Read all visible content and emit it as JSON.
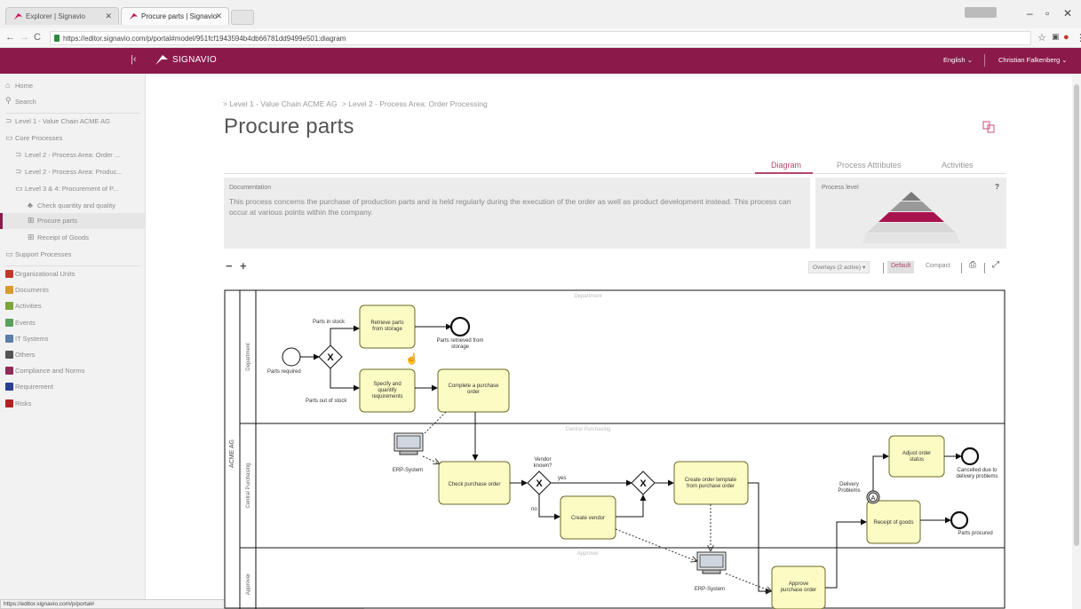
{
  "browser": {
    "tabs": [
      {
        "label": "Explorer | Signavio",
        "active": false
      },
      {
        "label": "Procure parts | Signavio",
        "active": true
      }
    ],
    "url": "https://editor.signavio.com/p/portal#model/951fcf1943594b4db66781dd9499e501:diagram",
    "status_url": "https://editor.signavio.com/p/portal#"
  },
  "header": {
    "brand": "SIGNAVIO",
    "language": "English",
    "user": "Christian Falkenberg",
    "bar_color": "#8b1a4b"
  },
  "sidebar": {
    "items": [
      {
        "label": "Home",
        "icon": "home-icon"
      },
      {
        "label": "Search",
        "icon": "search-icon"
      },
      {
        "label": "Level 1 - Value Chain ACME AG",
        "icon": "value-chain-icon"
      },
      {
        "label": "Core Processes",
        "icon": "folder-open-icon"
      },
      {
        "label": "Level 2 - Process Area: Order ...",
        "icon": "value-chain-icon"
      },
      {
        "label": "Level 2 - Process Area: Produc...",
        "icon": "value-chain-icon"
      },
      {
        "label": "Level 3 & 4: Procurement of P...",
        "icon": "folder-open-icon"
      },
      {
        "label": "Check quantity and quality",
        "icon": "org-chart-icon"
      },
      {
        "label": "Procure parts",
        "icon": "process-icon",
        "active": true
      },
      {
        "label": "Receipt of Goods",
        "icon": "process-icon"
      },
      {
        "label": "Support Processes",
        "icon": "folder-icon"
      }
    ],
    "dictionary": [
      {
        "label": "Organizational Units",
        "color": "#c0392b"
      },
      {
        "label": "Documents",
        "color": "#d69a2d"
      },
      {
        "label": "Activities",
        "color": "#7fa33b"
      },
      {
        "label": "Events",
        "color": "#5aa05a"
      },
      {
        "label": "IT Systems",
        "color": "#5a7fa8"
      },
      {
        "label": "Others",
        "color": "#555555"
      },
      {
        "label": "Compliance and Norms",
        "color": "#8e2b5a"
      },
      {
        "label": "Requirement",
        "color": "#2c3e8f"
      },
      {
        "label": "Risks",
        "color": "#b22222"
      }
    ]
  },
  "main": {
    "breadcrumb": [
      {
        "label": "> Level 1 - Value Chain ACME AG"
      },
      {
        "label": "> Level 2 - Process Area: Order Processing"
      }
    ],
    "title": "Procure parts",
    "tabs": [
      {
        "label": "Diagram",
        "active": true
      },
      {
        "label": "Process Attributes",
        "active": false
      },
      {
        "label": "Activities",
        "active": false
      }
    ],
    "documentation_label": "Documentation",
    "documentation": "This process concerns the purchase of production parts and is held regularly during the execution of the order as well as product development instead. This process can occur at various points within the company.",
    "process_level_label": "Process level",
    "process_level_help": "?",
    "toolbar": {
      "zoom_out": "−",
      "zoom_in": "+",
      "overlays": "Overlays (2 active)",
      "view_default": "Default",
      "view_compact": "Compact"
    }
  },
  "diagram": {
    "pool": "ACME AG",
    "lanes": [
      "Department",
      "Central Purchasing",
      "Approver"
    ],
    "labels": {
      "parts_in_stock": "Parts in stock",
      "parts_out_of_stock": "Parts out of stock",
      "parts_required": "Parts required",
      "retrieve_parts": [
        "Retrieve parts",
        "from storage"
      ],
      "parts_retrieved": [
        "Parts retrieved from",
        "storage"
      ],
      "specify": [
        "Specify and",
        "quantify",
        "requirements"
      ],
      "complete_po": [
        "Complete a purchase",
        "order"
      ],
      "erp1": "ERP-System",
      "check_po": "Check purchase order",
      "vendor_known": [
        "Vendor",
        "known?"
      ],
      "yes": "yes",
      "no": "no",
      "create_vendor": "Create vendor",
      "create_template": [
        "Create order template",
        "from purchase order"
      ],
      "erp2": "ERP-System",
      "approve_po": [
        "Approve",
        "purchase order"
      ],
      "delivery_problems": [
        "Delivery",
        "Problems"
      ],
      "adjust_status": [
        "Adjust order",
        "status"
      ],
      "cancelled": [
        "Cancelled due to",
        "delivery problems"
      ],
      "receipt_goods": "Receipt of goods",
      "parts_procured": "Parts procured"
    },
    "colors": {
      "task_fill": "#fbfbc4",
      "task_stroke": "#6b6b2a"
    }
  }
}
